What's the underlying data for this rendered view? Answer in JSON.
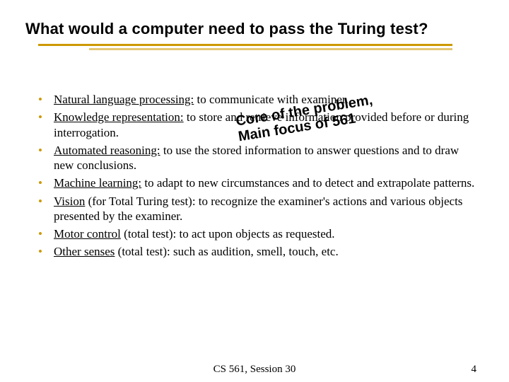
{
  "title": "What would a computer need to pass the Turing test?",
  "bullets": [
    {
      "lead": "Natural language processing:",
      "rest": " to communicate with examiner."
    },
    {
      "lead": "Knowledge representation:",
      "rest": " to store and retrieve information provided before or during interrogation."
    },
    {
      "lead": "Automated reasoning:",
      "rest": " to use the stored information to answer questions and to draw new conclusions."
    },
    {
      "lead": "Machine learning:",
      "rest": " to adapt to new circumstances and to detect and extrapolate patterns."
    },
    {
      "lead": "Vision",
      "rest": " (for Total Turing test): to recognize the examiner's actions and various objects presented by the examiner."
    },
    {
      "lead": "Motor control",
      "rest": " (total test): to act upon objects as requested."
    },
    {
      "lead": "Other senses",
      "rest": " (total test): such as audition, smell, touch, etc."
    }
  ],
  "overlay": {
    "line1": "Core of the problem,",
    "line2": "Main focus of 561"
  },
  "footer": {
    "center": "CS 561, Session 30",
    "page": "4"
  }
}
